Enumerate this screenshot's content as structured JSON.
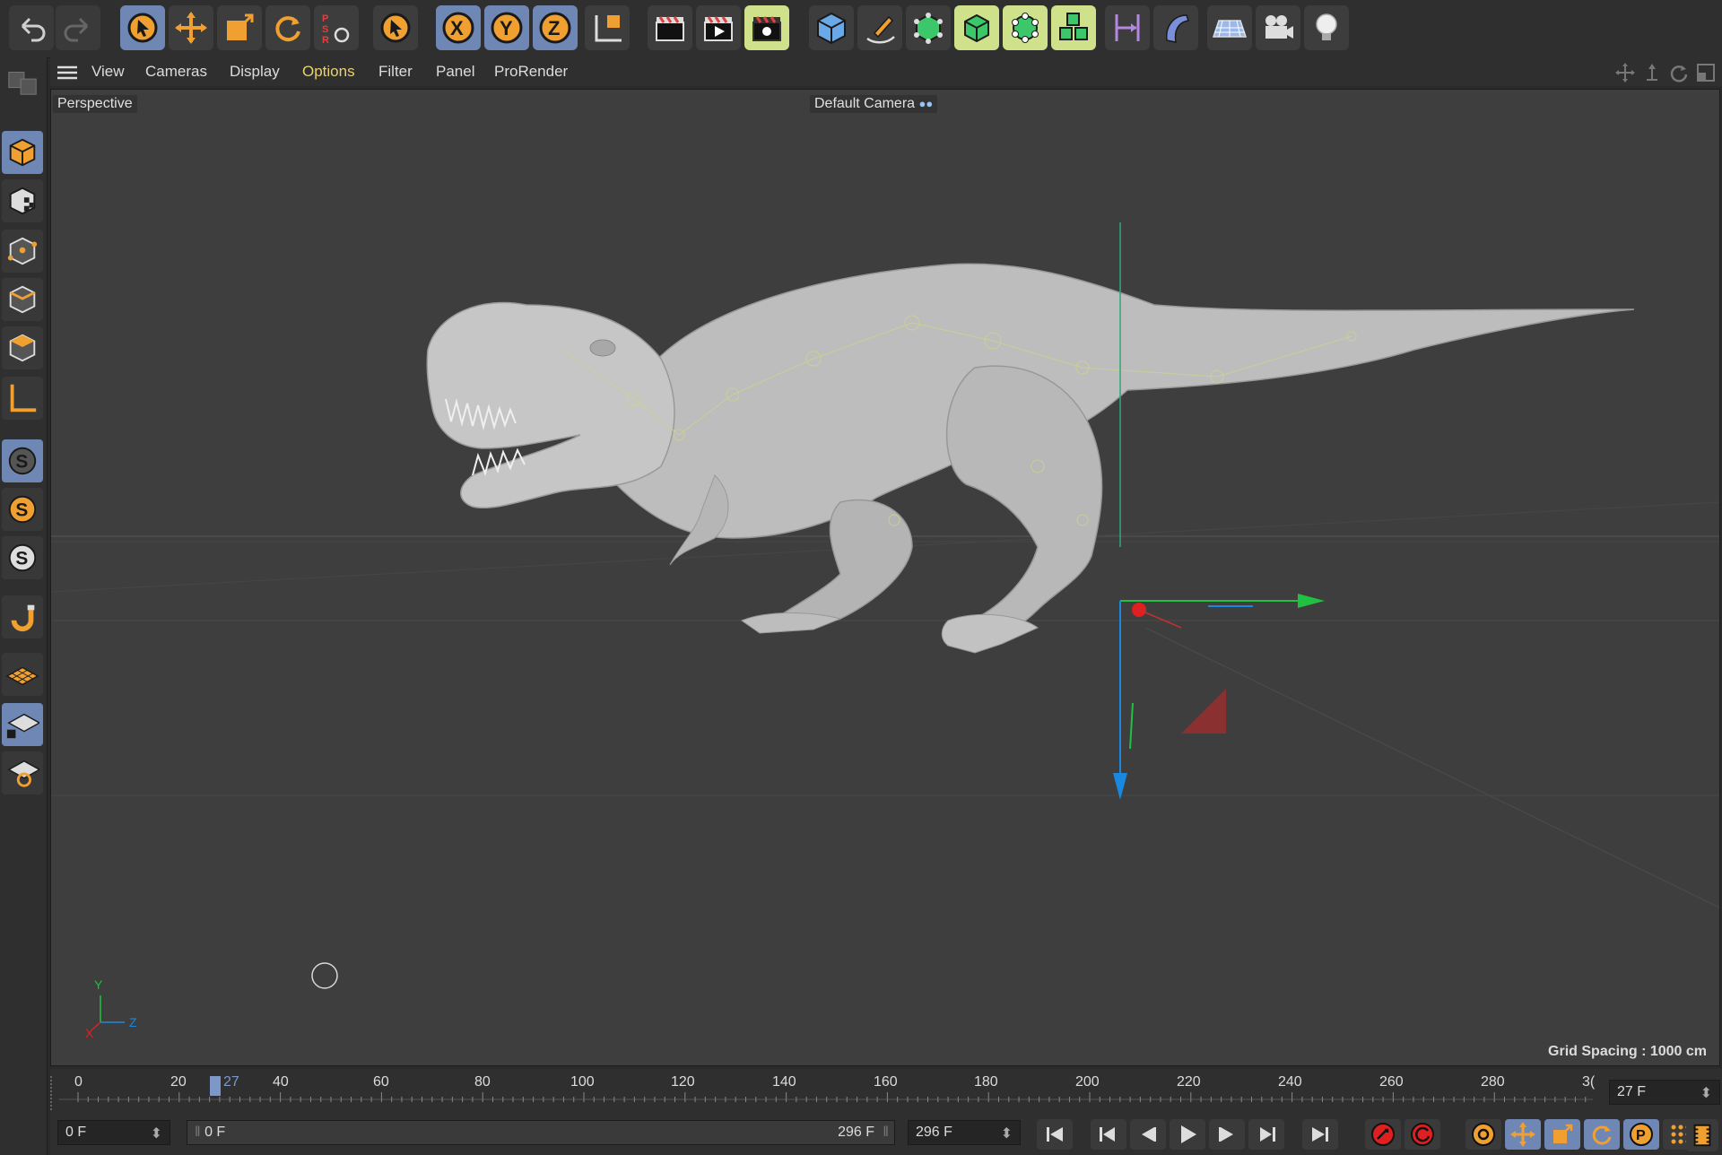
{
  "menu": {
    "items": [
      "View",
      "Cameras",
      "Display",
      "Options",
      "Filter",
      "Panel",
      "ProRender"
    ],
    "active": "Options"
  },
  "viewport": {
    "view_name": "Perspective",
    "camera_name": "Default Camera",
    "grid_spacing": "Grid Spacing : 1000 cm",
    "axis_labels": {
      "y": "Y",
      "z": "Z",
      "x": "X"
    }
  },
  "timeline": {
    "ticks": [
      "0",
      "20",
      "40",
      "60",
      "80",
      "100",
      "120",
      "140",
      "160",
      "180",
      "200",
      "220",
      "240",
      "260",
      "280",
      "3("
    ],
    "current_marker": "27",
    "current_frame_field": "27 F"
  },
  "transport": {
    "start_field": "0 F",
    "range_start": "0 F",
    "range_end": "296 F",
    "end_field": "296 F"
  },
  "colors": {
    "accent_orange": "#f0a030",
    "active_blue": "#6f87b4",
    "axis_red": "#e02020",
    "axis_green": "#20c040",
    "axis_blue": "#1a88e0",
    "highlight_yellow": "#e8d174"
  }
}
